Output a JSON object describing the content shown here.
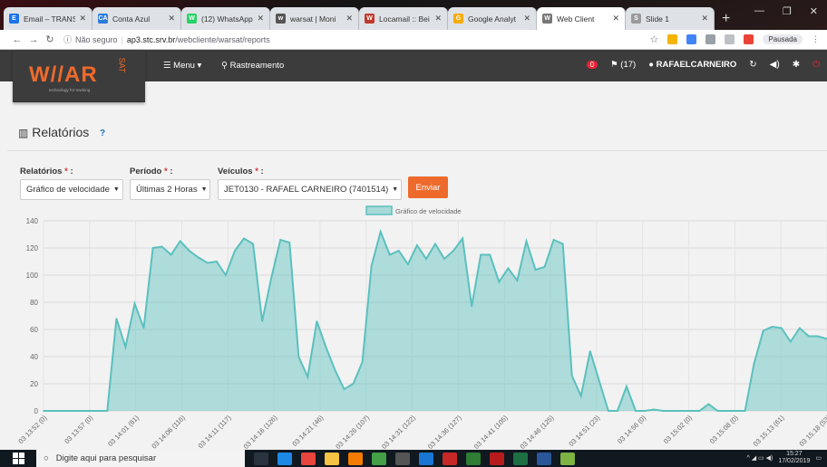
{
  "browser": {
    "tabs": [
      {
        "label": "Email – TRANS",
        "fav_color": "#1a73e8",
        "fav_text": "E"
      },
      {
        "label": "Conta Azul",
        "fav_color": "#2b7bd9",
        "fav_text": "CA"
      },
      {
        "label": "(12) WhatsApp",
        "fav_color": "#25d366",
        "fav_text": "W"
      },
      {
        "label": "warsat | Moni",
        "fav_color": "#555555",
        "fav_text": "w"
      },
      {
        "label": "Locamail :: Bei",
        "fav_color": "#c0392b",
        "fav_text": "W"
      },
      {
        "label": "Google Analyt",
        "fav_color": "#f9ab00",
        "fav_text": "G"
      },
      {
        "label": "Web Client",
        "fav_color": "#777777",
        "fav_text": "W",
        "active": true
      },
      {
        "label": "Slide 1",
        "fav_color": "#999999",
        "fav_text": "S"
      }
    ],
    "address": {
      "security": "Não seguro",
      "host": "ap3.stc.srv.br",
      "path": "/webcliente/warsat/reports"
    },
    "paused_label": "Pausada"
  },
  "app": {
    "logo_text": "W//AR",
    "logo_sat": "SAT",
    "logo_tagline": "technology for tracking",
    "menu_label": "☰ Menu ▾",
    "rastreamento_label": "Rastreamento",
    "alert_count": "0",
    "flag_count": "(17)",
    "user_name": "RAFAELCARNEIRO"
  },
  "page": {
    "title": "Relatórios",
    "help": "?",
    "filters": {
      "relatorios_label": "Relatórios",
      "relatorios_value": "Gráfico de velocidade",
      "periodo_label": "Período",
      "periodo_value": "Últimas 2 Horas",
      "veiculos_label": "Veículos",
      "veiculos_value": "JET0130 - RAFAEL CARNEIRO (7401514)",
      "required_mark": "*",
      "colon": ":",
      "submit_label": "Enviar"
    }
  },
  "chart_data": {
    "type": "area",
    "title": "",
    "legend": [
      "Gráfico de velocidade"
    ],
    "legend_position": "top",
    "ylim": [
      0,
      140
    ],
    "yticks": [
      0,
      20,
      40,
      60,
      80,
      100,
      120,
      140
    ],
    "grid": true,
    "series_color": "#5bc0be",
    "x_tick_labels": [
      "03 13:52 (0)",
      "03 13:57 (0)",
      "03 14:01 (61)",
      "03 14:06 (116)",
      "03 14:11 (117)",
      "03 14:16 (126)",
      "03 14:21 (46)",
      "03 14:26 (107)",
      "03 14:31 (122)",
      "03 14:36 (127)",
      "03 14:41 (105)",
      "03 14:46 (125)",
      "03 14:51 (23)",
      "03 14:56 (0)",
      "03 15:02 (0)",
      "03 15:08 (0)",
      "03 15:13 (61)",
      "03 15:18 (53)"
    ],
    "values": [
      0,
      0,
      0,
      0,
      0,
      0,
      0,
      0,
      68,
      47,
      79,
      61,
      120,
      121,
      115,
      125,
      118,
      113,
      109,
      110,
      100,
      118,
      127,
      123,
      66,
      98,
      126,
      124,
      40,
      25,
      66,
      47,
      30,
      16,
      20,
      36,
      107,
      132,
      115,
      118,
      108,
      122,
      112,
      123,
      112,
      118,
      127,
      77,
      115,
      115,
      95,
      105,
      96,
      125,
      104,
      106,
      126,
      123,
      26,
      11,
      44,
      22,
      0,
      0,
      18,
      0,
      0,
      1,
      0,
      0,
      0,
      0,
      0,
      5,
      0,
      0,
      0,
      0,
      35,
      59,
      62,
      61,
      51,
      61,
      55,
      55,
      53
    ]
  }
}
